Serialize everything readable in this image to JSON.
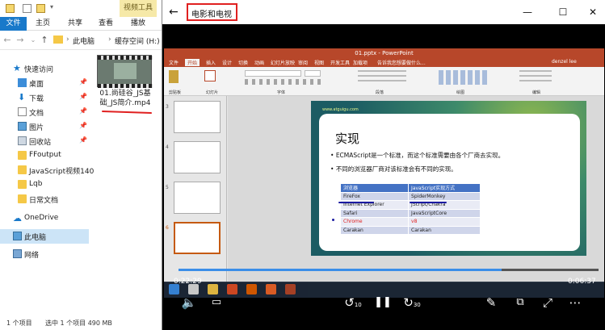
{
  "explorer": {
    "context_tab": "视频工具",
    "tabs": [
      "文件",
      "主页",
      "共享",
      "查看",
      "播放"
    ],
    "breadcrumb": [
      "此电脑",
      "缓存空间 (H:)"
    ],
    "nav": [
      {
        "label": "快速访问",
        "icon": "star-icon"
      },
      {
        "label": "桌面",
        "icon": "desktop-icon",
        "pinned": true
      },
      {
        "label": "下载",
        "icon": "download-icon",
        "pinned": true
      },
      {
        "label": "文档",
        "icon": "document-icon",
        "pinned": true
      },
      {
        "label": "图片",
        "icon": "picture-icon",
        "pinned": true
      },
      {
        "label": "回收站",
        "icon": "recycle-bin-icon",
        "pinned": true
      },
      {
        "label": "FFoutput",
        "icon": "folder-icon"
      },
      {
        "label": "JavaScript视频140",
        "icon": "folder-icon"
      },
      {
        "label": "Lqb",
        "icon": "folder-icon"
      },
      {
        "label": "日常文档",
        "icon": "folder-icon"
      },
      {
        "label": "OneDrive",
        "icon": "cloud-icon"
      },
      {
        "label": "此电脑",
        "icon": "computer-icon",
        "selected": true
      },
      {
        "label": "网络",
        "icon": "network-icon"
      }
    ],
    "file": {
      "line1": "01.尚硅谷_JS基",
      "line2": "础_JS简介.mp4"
    },
    "status": {
      "count": "1 个项目",
      "selected": "选中 1 个项目  490 MB"
    }
  },
  "player": {
    "title": "电影和电视",
    "time_elapsed": "0:22:29",
    "time_remaining": "0:06:37",
    "progress": 0.77,
    "skip_back": "10",
    "skip_forward": "30"
  },
  "ppt": {
    "window_title": "01.pptx - PowerPoint",
    "user": "denzel lee",
    "tabs": [
      "文件",
      "开始",
      "插入",
      "设计",
      "切换",
      "动画",
      "幻灯片放映",
      "审阅",
      "视图",
      "开发工具",
      "加载项",
      "告诉我您想要做什么..."
    ],
    "active_tab": "开始",
    "ribbon_groups": [
      "剪贴板",
      "幻灯片",
      "字体",
      "段落",
      "绘图",
      "编辑"
    ],
    "slide_numbers": [
      "3",
      "4",
      "5",
      "6"
    ],
    "slide": {
      "url": "www.atguigu.com",
      "heading": "实现",
      "bullets": [
        "ECMAScript是一个标准，而这个标准需要由各个厂商去实现。",
        "不同的浏览器厂商对该标准会有不同的实现。"
      ],
      "table_header": [
        "浏览器",
        "JavaScript实现方式"
      ],
      "table_rows": [
        [
          "FireFox",
          "SpiderMonkey"
        ],
        [
          "Internet Explorer",
          "JScript/Chakra"
        ],
        [
          "Safari",
          "JavaScriptCore"
        ],
        [
          "Chrome",
          "v8"
        ],
        [
          "Carakan",
          "Carakan"
        ]
      ]
    }
  }
}
